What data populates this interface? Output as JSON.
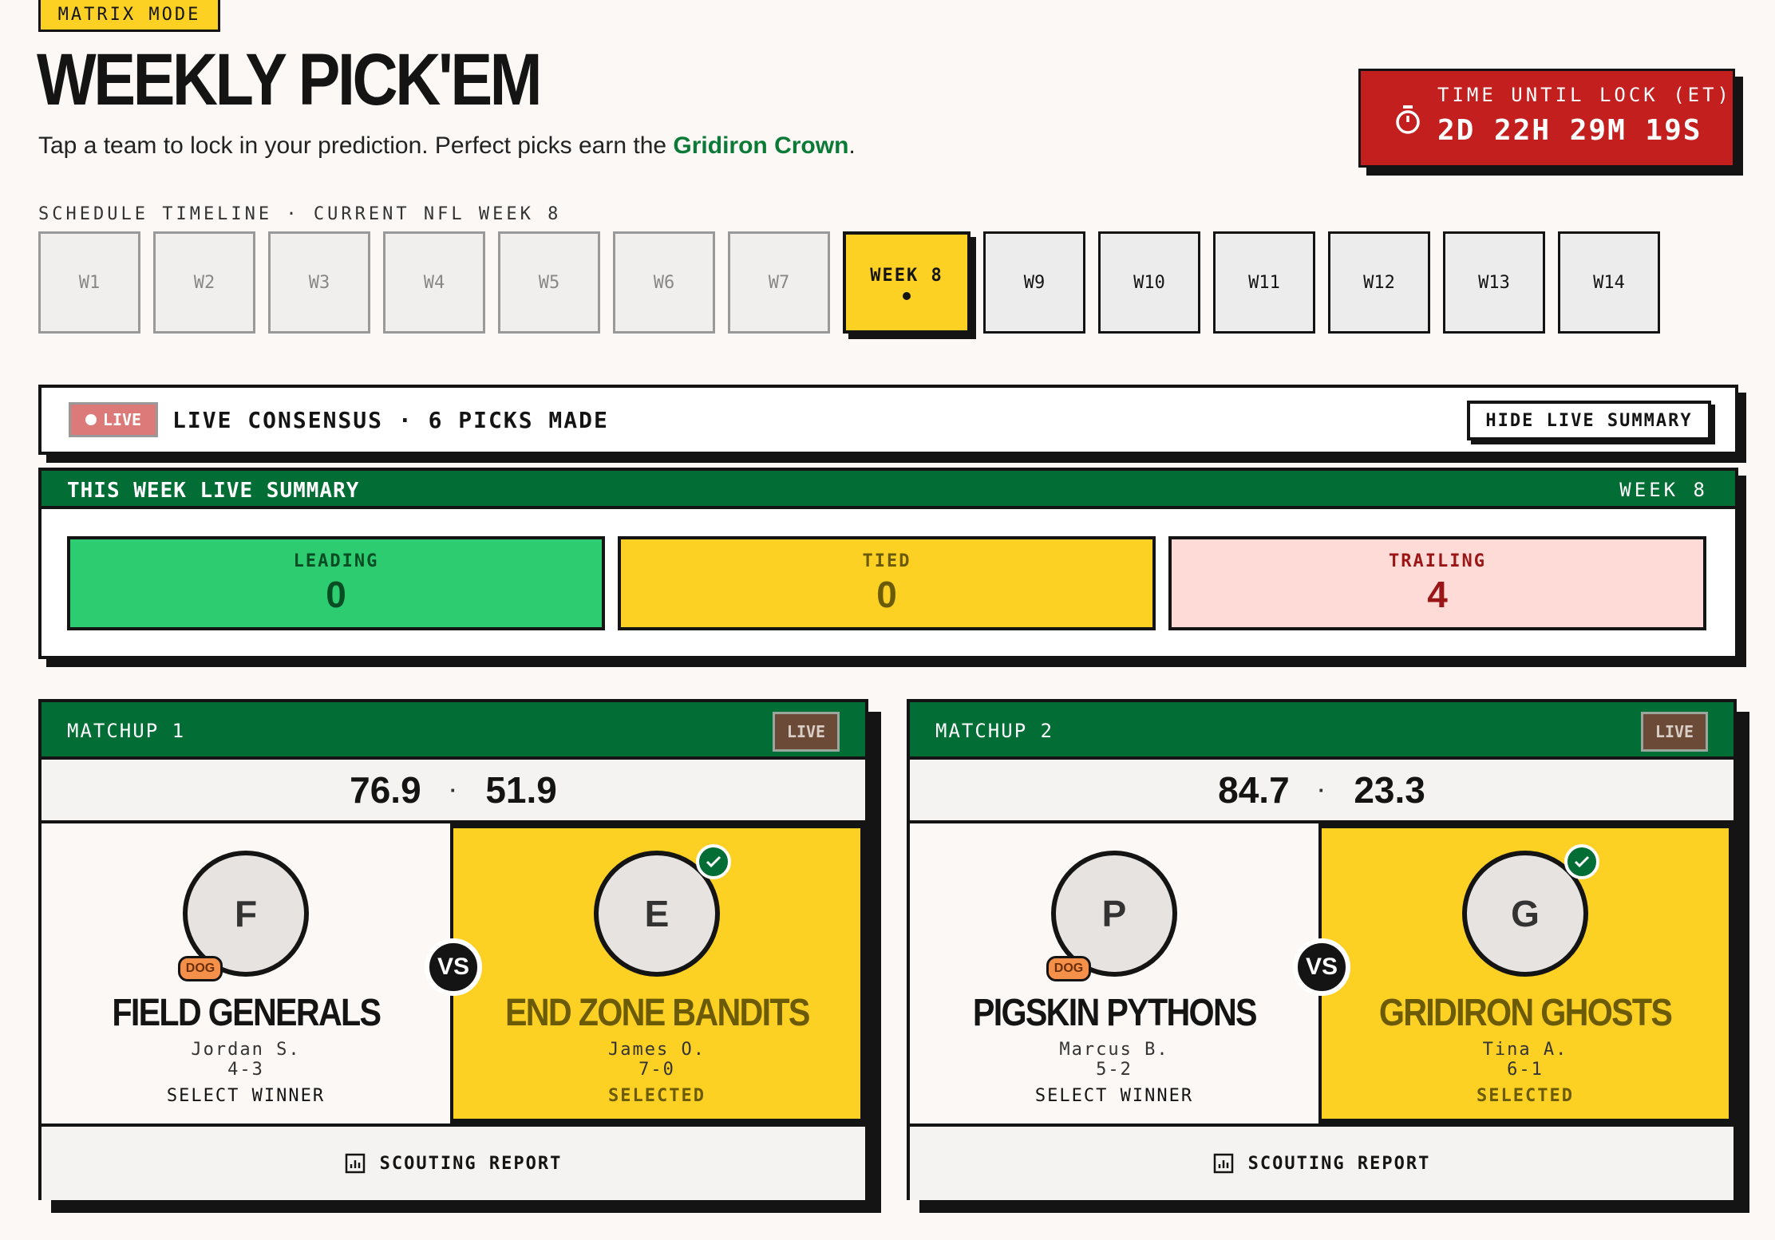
{
  "mode_badge": "MATRIX MODE",
  "page_title": "WEEKLY PICK'EM",
  "subtitle": {
    "prefix": "Tap a team to lock in your prediction. Perfect picks earn the ",
    "accent": "Gridiron Crown",
    "suffix": "."
  },
  "lock": {
    "label": "TIME UNTIL LOCK (ET)",
    "value": "2D 22H 29M 19S",
    "icon": "stopwatch-icon"
  },
  "timeline": {
    "label": "SCHEDULE TIMELINE · CURRENT NFL WEEK 8",
    "weeks": [
      {
        "label": "W1",
        "state": "past"
      },
      {
        "label": "W2",
        "state": "past"
      },
      {
        "label": "W3",
        "state": "past"
      },
      {
        "label": "W4",
        "state": "past"
      },
      {
        "label": "W5",
        "state": "past"
      },
      {
        "label": "W6",
        "state": "past"
      },
      {
        "label": "W7",
        "state": "past"
      },
      {
        "label": "WEEK 8",
        "state": "current"
      },
      {
        "label": "W9",
        "state": "future"
      },
      {
        "label": "W10",
        "state": "future"
      },
      {
        "label": "W11",
        "state": "future"
      },
      {
        "label": "W12",
        "state": "future"
      },
      {
        "label": "W13",
        "state": "future"
      },
      {
        "label": "W14",
        "state": "future"
      }
    ]
  },
  "consensus": {
    "live": "LIVE",
    "text": "LIVE CONSENSUS · 6 PICKS MADE",
    "hide_label": "HIDE LIVE SUMMARY"
  },
  "summary": {
    "title": "THIS WEEK LIVE SUMMARY",
    "week": "WEEK 8",
    "leading": {
      "label": "LEADING",
      "value": "0"
    },
    "tied": {
      "label": "TIED",
      "value": "0"
    },
    "trailing": {
      "label": "TRAILING",
      "value": "4"
    }
  },
  "matchups": [
    {
      "title": "MATCHUP 1",
      "live": "LIVE",
      "score_a": "76.9",
      "sep": "·",
      "score_b": "51.9",
      "vs": "VS",
      "team_a": {
        "initial": "F",
        "badge": "DOG",
        "name": "FIELD GENERALS",
        "owner": "Jordan S.",
        "record": "4-3",
        "action": "SELECT WINNER"
      },
      "team_b": {
        "initial": "E",
        "name": "END ZONE BANDITS",
        "owner": "James O.",
        "record": "7-0",
        "action": "SELECTED"
      },
      "scout": "SCOUTING REPORT"
    },
    {
      "title": "MATCHUP 2",
      "live": "LIVE",
      "score_a": "84.7",
      "sep": "·",
      "score_b": "23.3",
      "vs": "VS",
      "team_a": {
        "initial": "P",
        "badge": "DOG",
        "name": "PIGSKIN PYTHONS",
        "owner": "Marcus B.",
        "record": "5-2",
        "action": "SELECT WINNER"
      },
      "team_b": {
        "initial": "G",
        "name": "GRIDIRON GHOSTS",
        "owner": "Tina A.",
        "record": "6-1",
        "action": "SELECTED"
      },
      "scout": "SCOUTING REPORT"
    }
  ],
  "colors": {
    "accent_green": "#026d34",
    "accent_yellow": "#fdd124",
    "alert_red": "#c41f1f"
  }
}
